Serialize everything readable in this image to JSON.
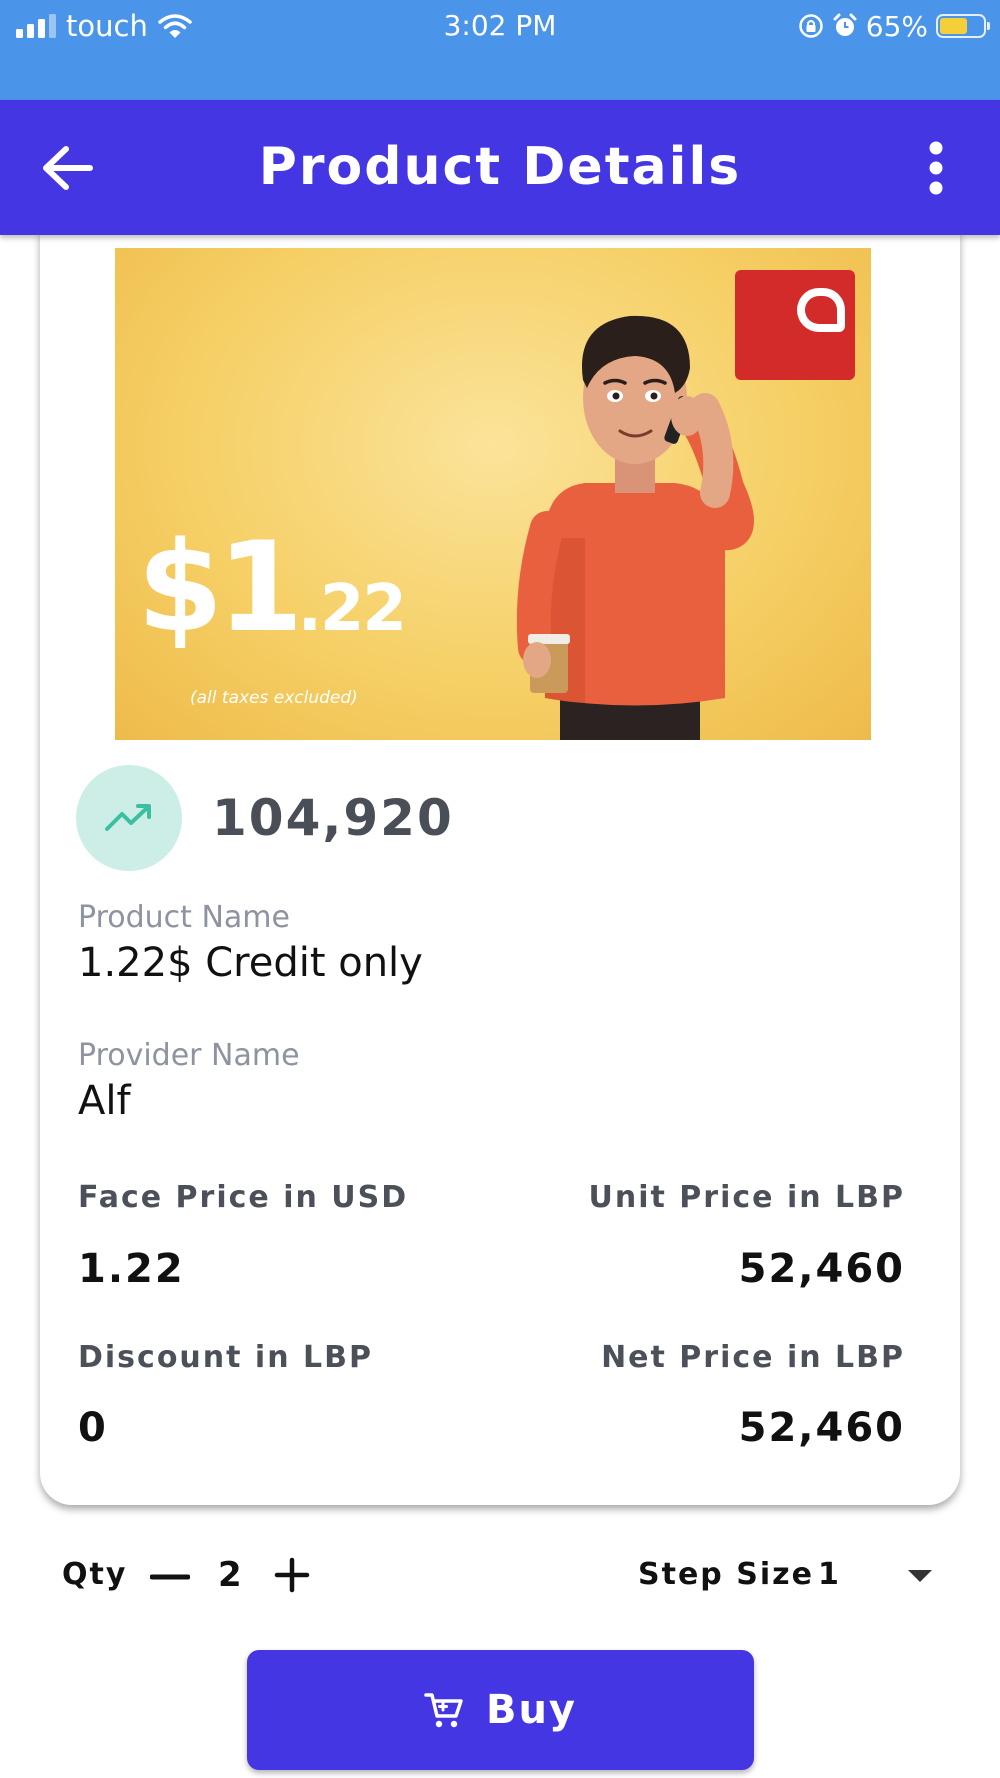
{
  "status_bar": {
    "carrier": "touch",
    "time": "3:02 PM",
    "battery": "65%",
    "battery_level": 0.65,
    "icons": [
      "signal-icon",
      "wifi-icon",
      "orientation-lock-icon",
      "alarm-icon",
      "battery-icon"
    ]
  },
  "app_bar": {
    "title": "Product Details",
    "back_icon": "arrow-left-icon",
    "menu_icon": "more-vertical-icon",
    "color": "#4536e4"
  },
  "product": {
    "banner": {
      "price_main": "$1",
      "price_cents": ".22",
      "tax_note": "(all taxes excluded)"
    },
    "stat_value": "104,920",
    "stat_icon": "trending-up-icon",
    "product_name_label": "Product Name",
    "product_name": "1.22$ Credit only",
    "provider_name_label": "Provider Name",
    "provider_name": "Alf",
    "face_price_label": "Face Price in USD",
    "face_price": "1.22",
    "unit_price_label": "Unit Price in LBP",
    "unit_price": "52,460",
    "discount_label": "Discount in LBP",
    "discount": "0",
    "net_price_label": "Net Price in LBP",
    "net_price": "52,460"
  },
  "order": {
    "qty_label": "Qty",
    "qty_value": "2",
    "step_size_label": "Step Size",
    "step_size_value": "1",
    "buy_label": "Buy",
    "buy_icon": "cart-icon"
  },
  "colors": {
    "status_bar": "#4a94ea",
    "primary": "#4536e4",
    "stat_icon_bg": "#cdeee6",
    "stat_icon_fg": "#3bbfa2",
    "brand_red": "#d32a2a"
  }
}
